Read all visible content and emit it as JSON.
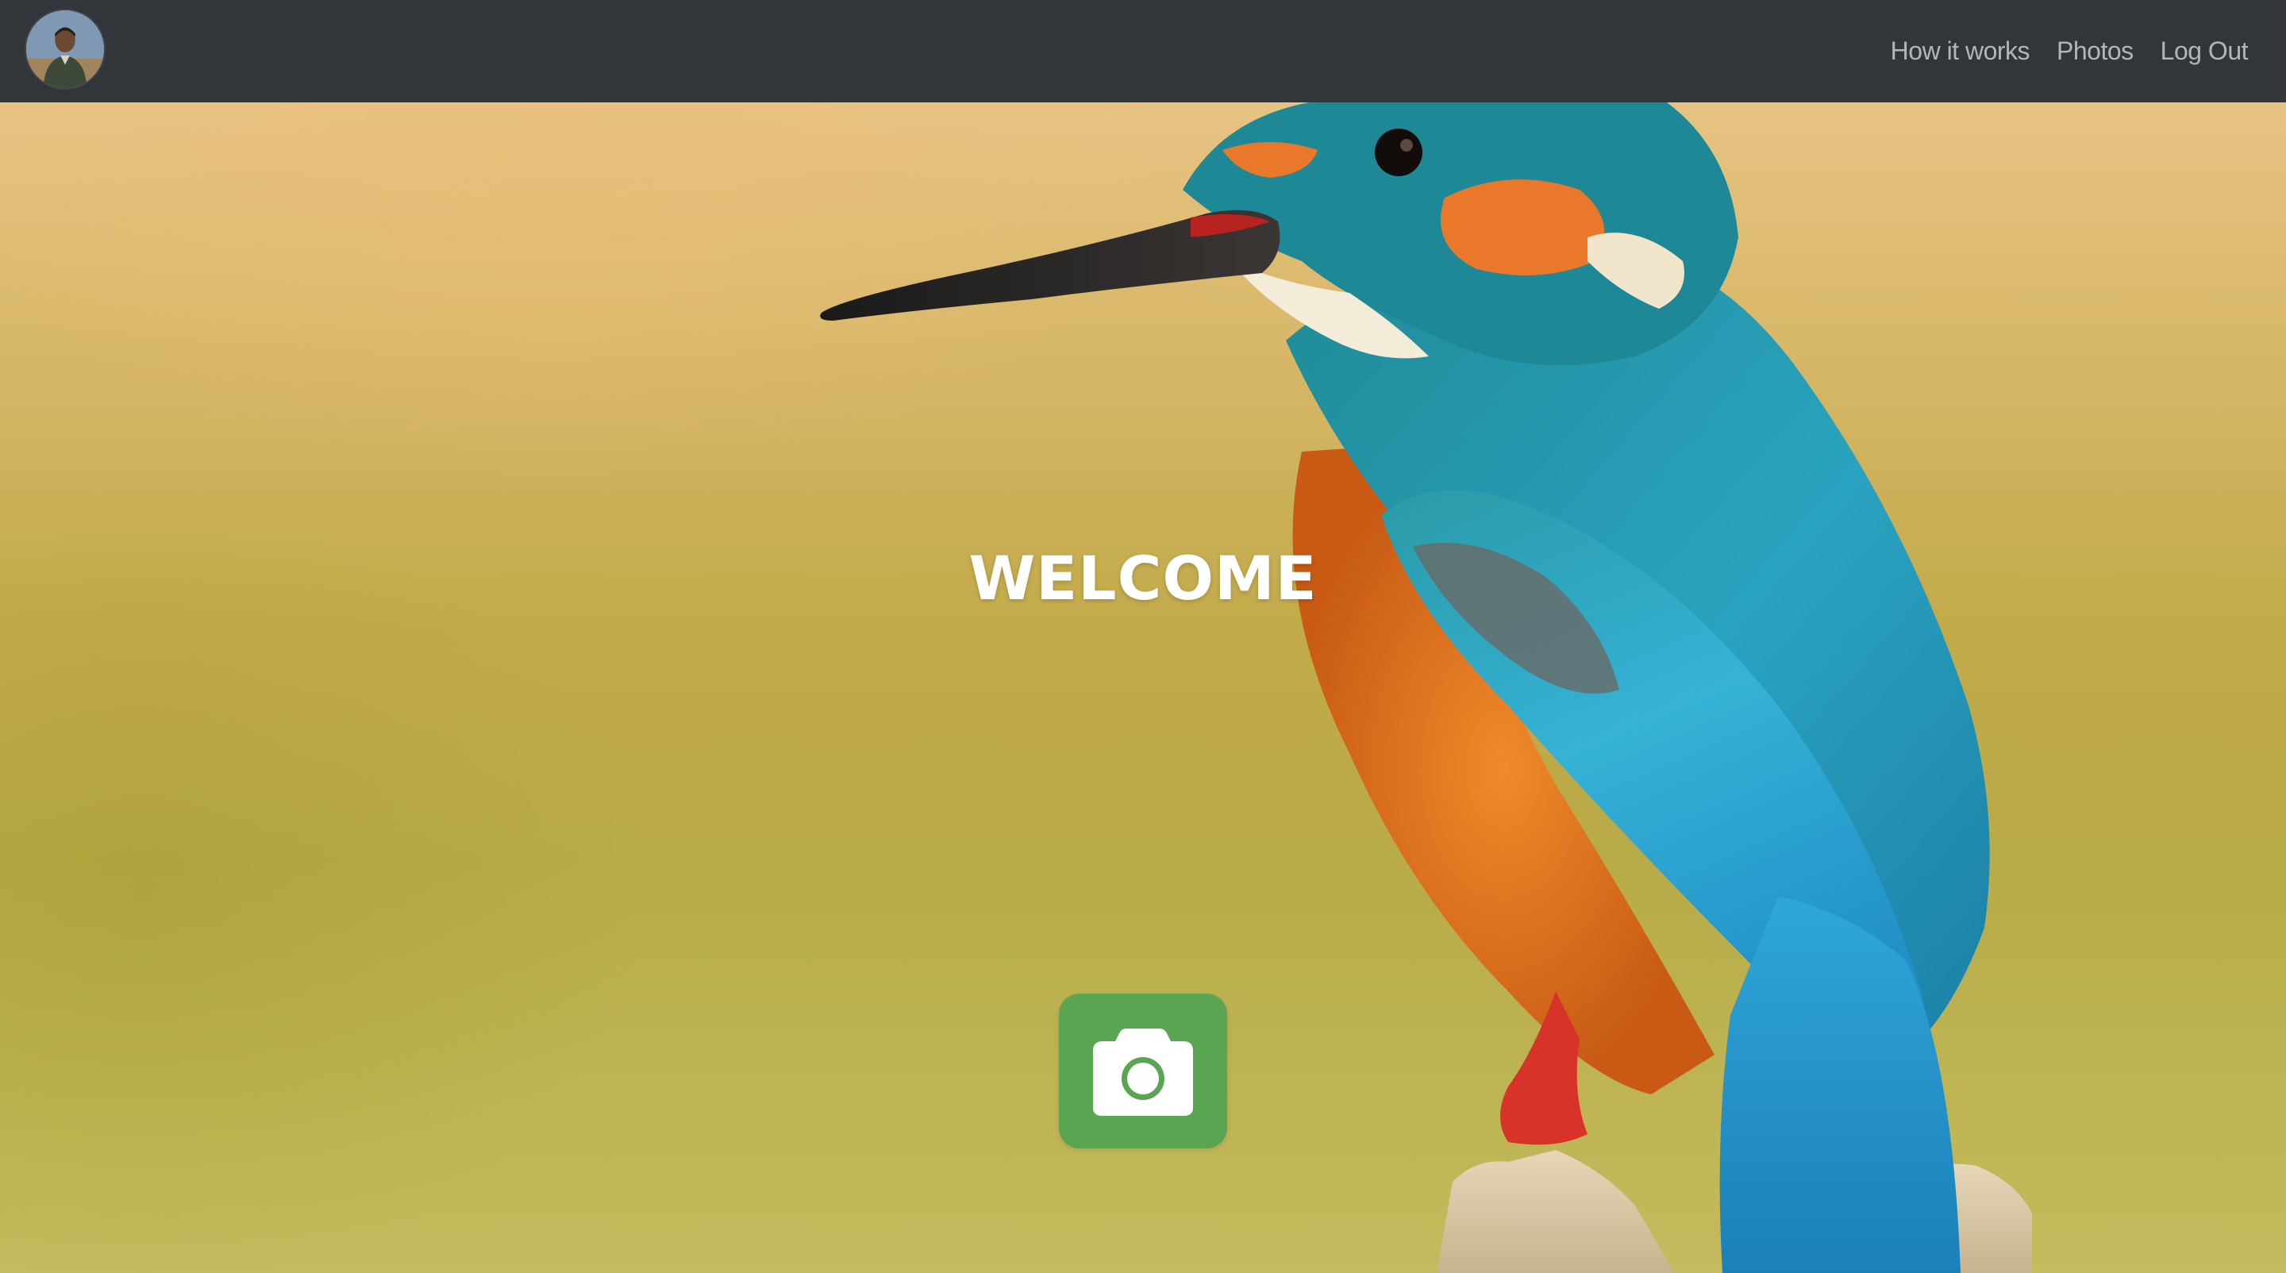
{
  "nav": {
    "links": [
      {
        "label": "How it works"
      },
      {
        "label": "Photos"
      },
      {
        "label": "Log Out"
      }
    ]
  },
  "hero": {
    "title": "WELCOME"
  },
  "icons": {
    "avatar": "user-avatar",
    "camera": "camera-icon"
  },
  "colors": {
    "navbar": "#31363b",
    "nav_link": "#b3b6b9",
    "camera_button": "#5aa552",
    "title": "#ffffff"
  }
}
